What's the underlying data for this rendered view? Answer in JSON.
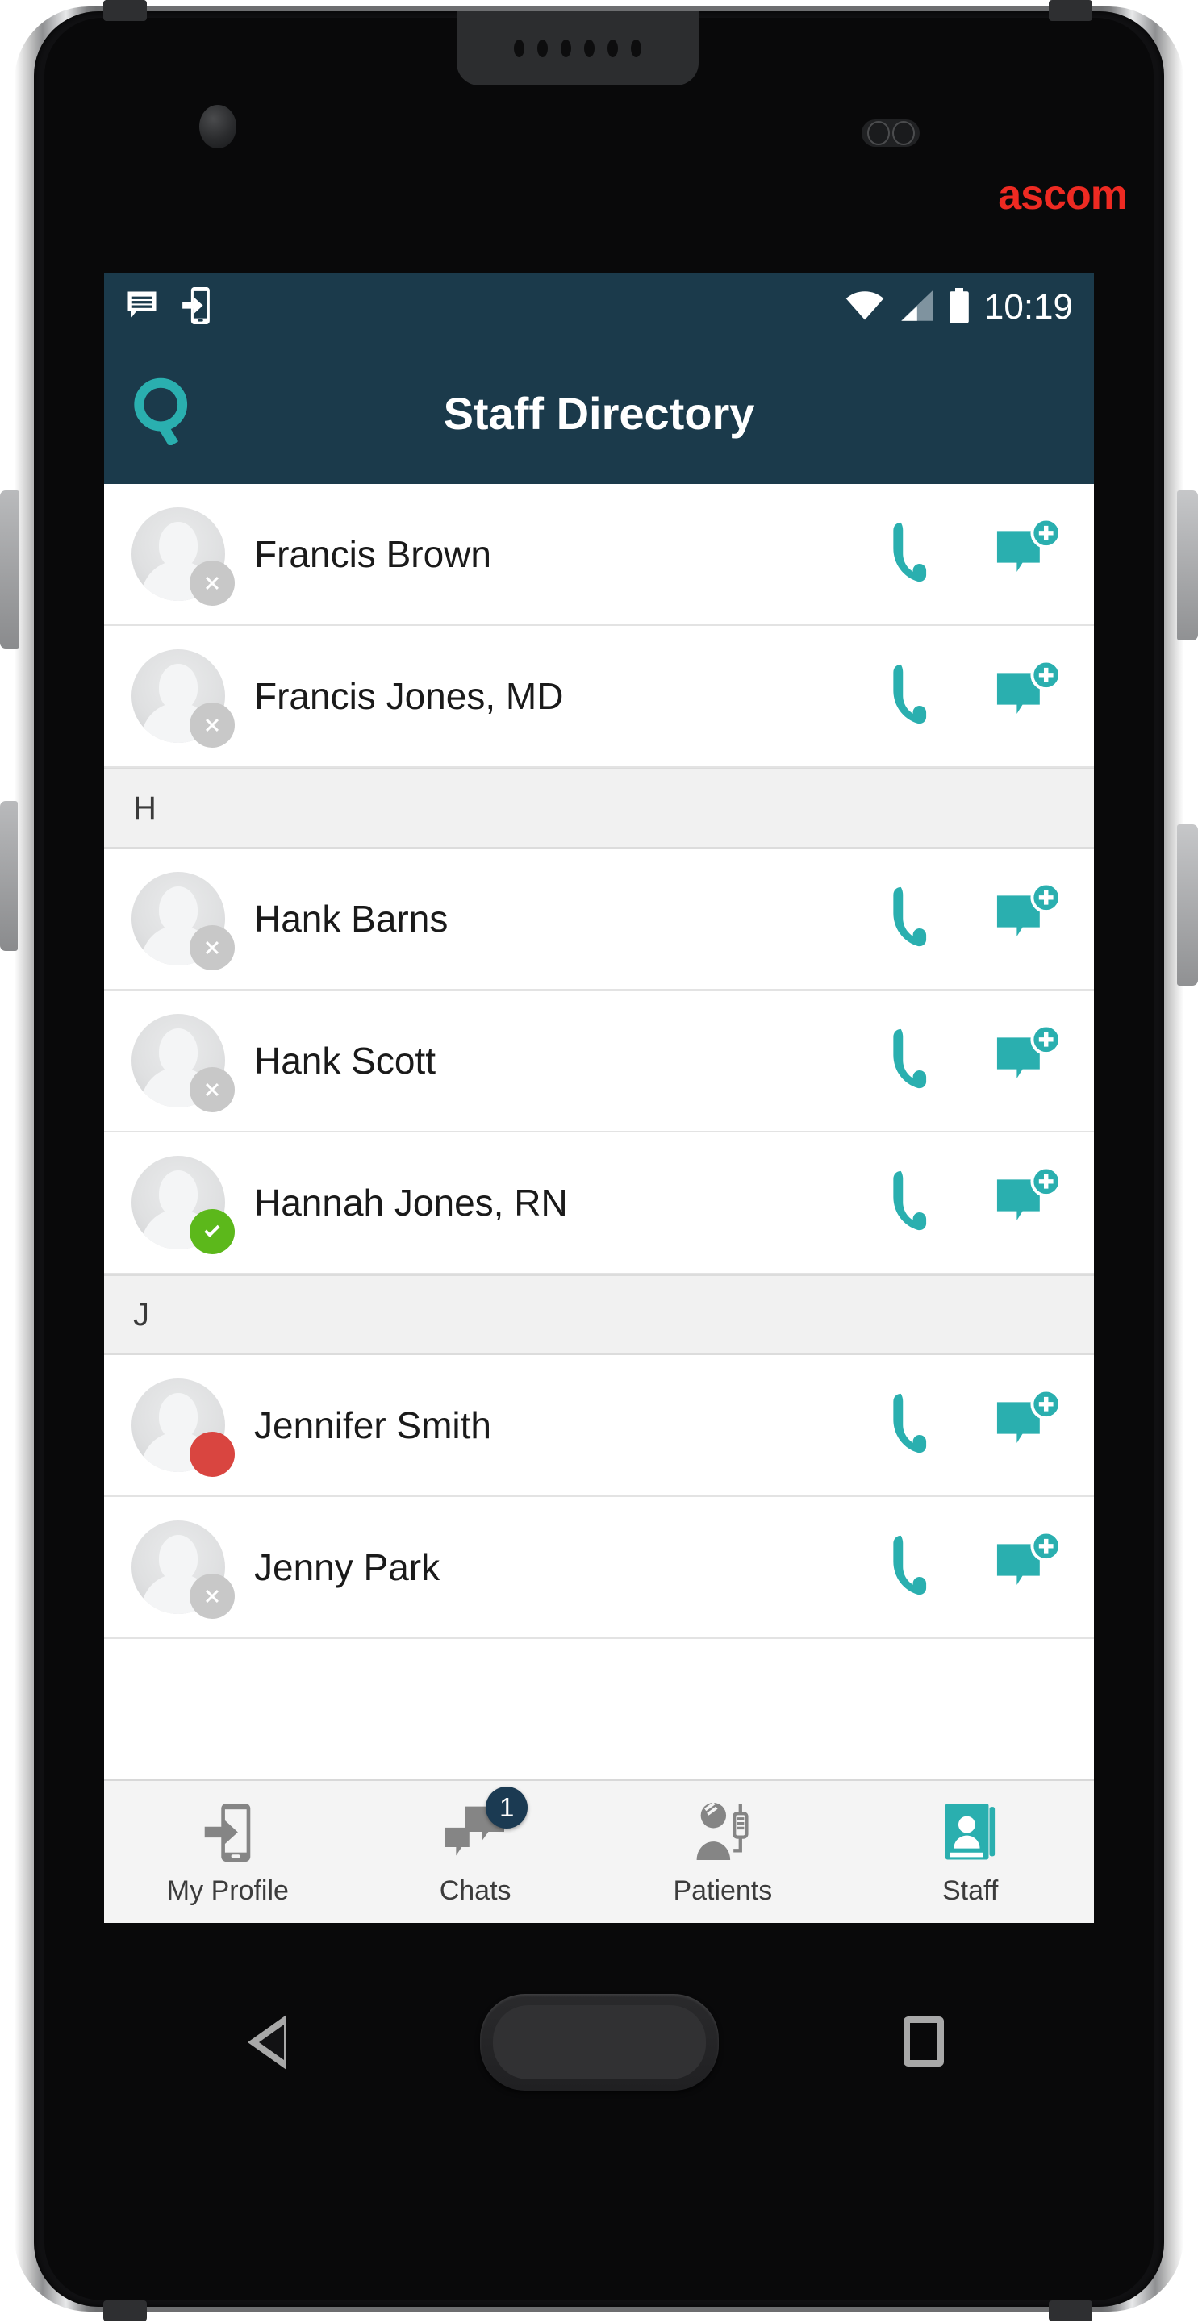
{
  "device": {
    "brand_logo": "ascom",
    "brand_color": "#ee2a22",
    "frame_color": "#6d6e70",
    "hardware": {
      "back_button": "back-triangle",
      "home_button": "home-rounded-rect",
      "recents_button": "recents-square",
      "earpiece": "earpiece-speaker",
      "front_camera": "front-camera",
      "proximity_sensor": "proximity-sensor"
    }
  },
  "theme": {
    "appbar_bg": "#1b3a4b",
    "accent_teal": "#2aafaf",
    "available_green": "#5cb81b",
    "busy_red": "#d94540",
    "unavailable_gray": "#c8c8c8",
    "badge_navy": "#1b3a52",
    "section_bg": "#f1f1f1"
  },
  "status_bar": {
    "time": "10:19",
    "left_icons": [
      "message-icon",
      "phone-handover-icon"
    ],
    "right_icons": [
      "wifi-icon",
      "cellular-signal-icon",
      "battery-icon"
    ],
    "wifi_level": "full",
    "signal_level": "half",
    "battery_level": "full"
  },
  "app_bar": {
    "title": "Staff Directory",
    "search_icon": "search-icon"
  },
  "staff_list": {
    "groups": [
      {
        "letter": "",
        "show_header": false,
        "people": [
          {
            "name": "Francis Brown",
            "presence": "unavailable",
            "avatar": "default-avatar",
            "call_label": "call-icon",
            "chat_label": "new-chat-icon"
          },
          {
            "name": "Francis Jones, MD",
            "presence": "unavailable",
            "avatar": "default-avatar",
            "call_label": "call-icon",
            "chat_label": "new-chat-icon"
          }
        ]
      },
      {
        "letter": "H",
        "show_header": true,
        "people": [
          {
            "name": "Hank Barns",
            "presence": "unavailable",
            "avatar": "default-avatar",
            "call_label": "call-icon",
            "chat_label": "new-chat-icon"
          },
          {
            "name": "Hank Scott",
            "presence": "unavailable",
            "avatar": "default-avatar",
            "call_label": "call-icon",
            "chat_label": "new-chat-icon"
          },
          {
            "name": "Hannah Jones, RN",
            "presence": "available",
            "avatar": "default-avatar",
            "call_label": "call-icon",
            "chat_label": "new-chat-icon"
          }
        ]
      },
      {
        "letter": "J",
        "show_header": true,
        "people": [
          {
            "name": "Jennifer Smith",
            "presence": "busy",
            "avatar": "default-avatar",
            "call_label": "call-icon",
            "chat_label": "new-chat-icon"
          },
          {
            "name": "Jenny Park",
            "presence": "unavailable",
            "avatar": "default-avatar",
            "call_label": "call-icon",
            "chat_label": "new-chat-icon"
          }
        ]
      }
    ]
  },
  "bottom_nav": {
    "items": [
      {
        "label": "My Profile",
        "icon": "phone-handover-icon",
        "active": false,
        "badge": ""
      },
      {
        "label": "Chats",
        "icon": "chats-icon",
        "active": false,
        "badge": "1"
      },
      {
        "label": "Patients",
        "icon": "patient-iv-icon",
        "active": false,
        "badge": ""
      },
      {
        "label": "Staff",
        "icon": "address-book-icon",
        "active": true,
        "badge": ""
      }
    ]
  }
}
